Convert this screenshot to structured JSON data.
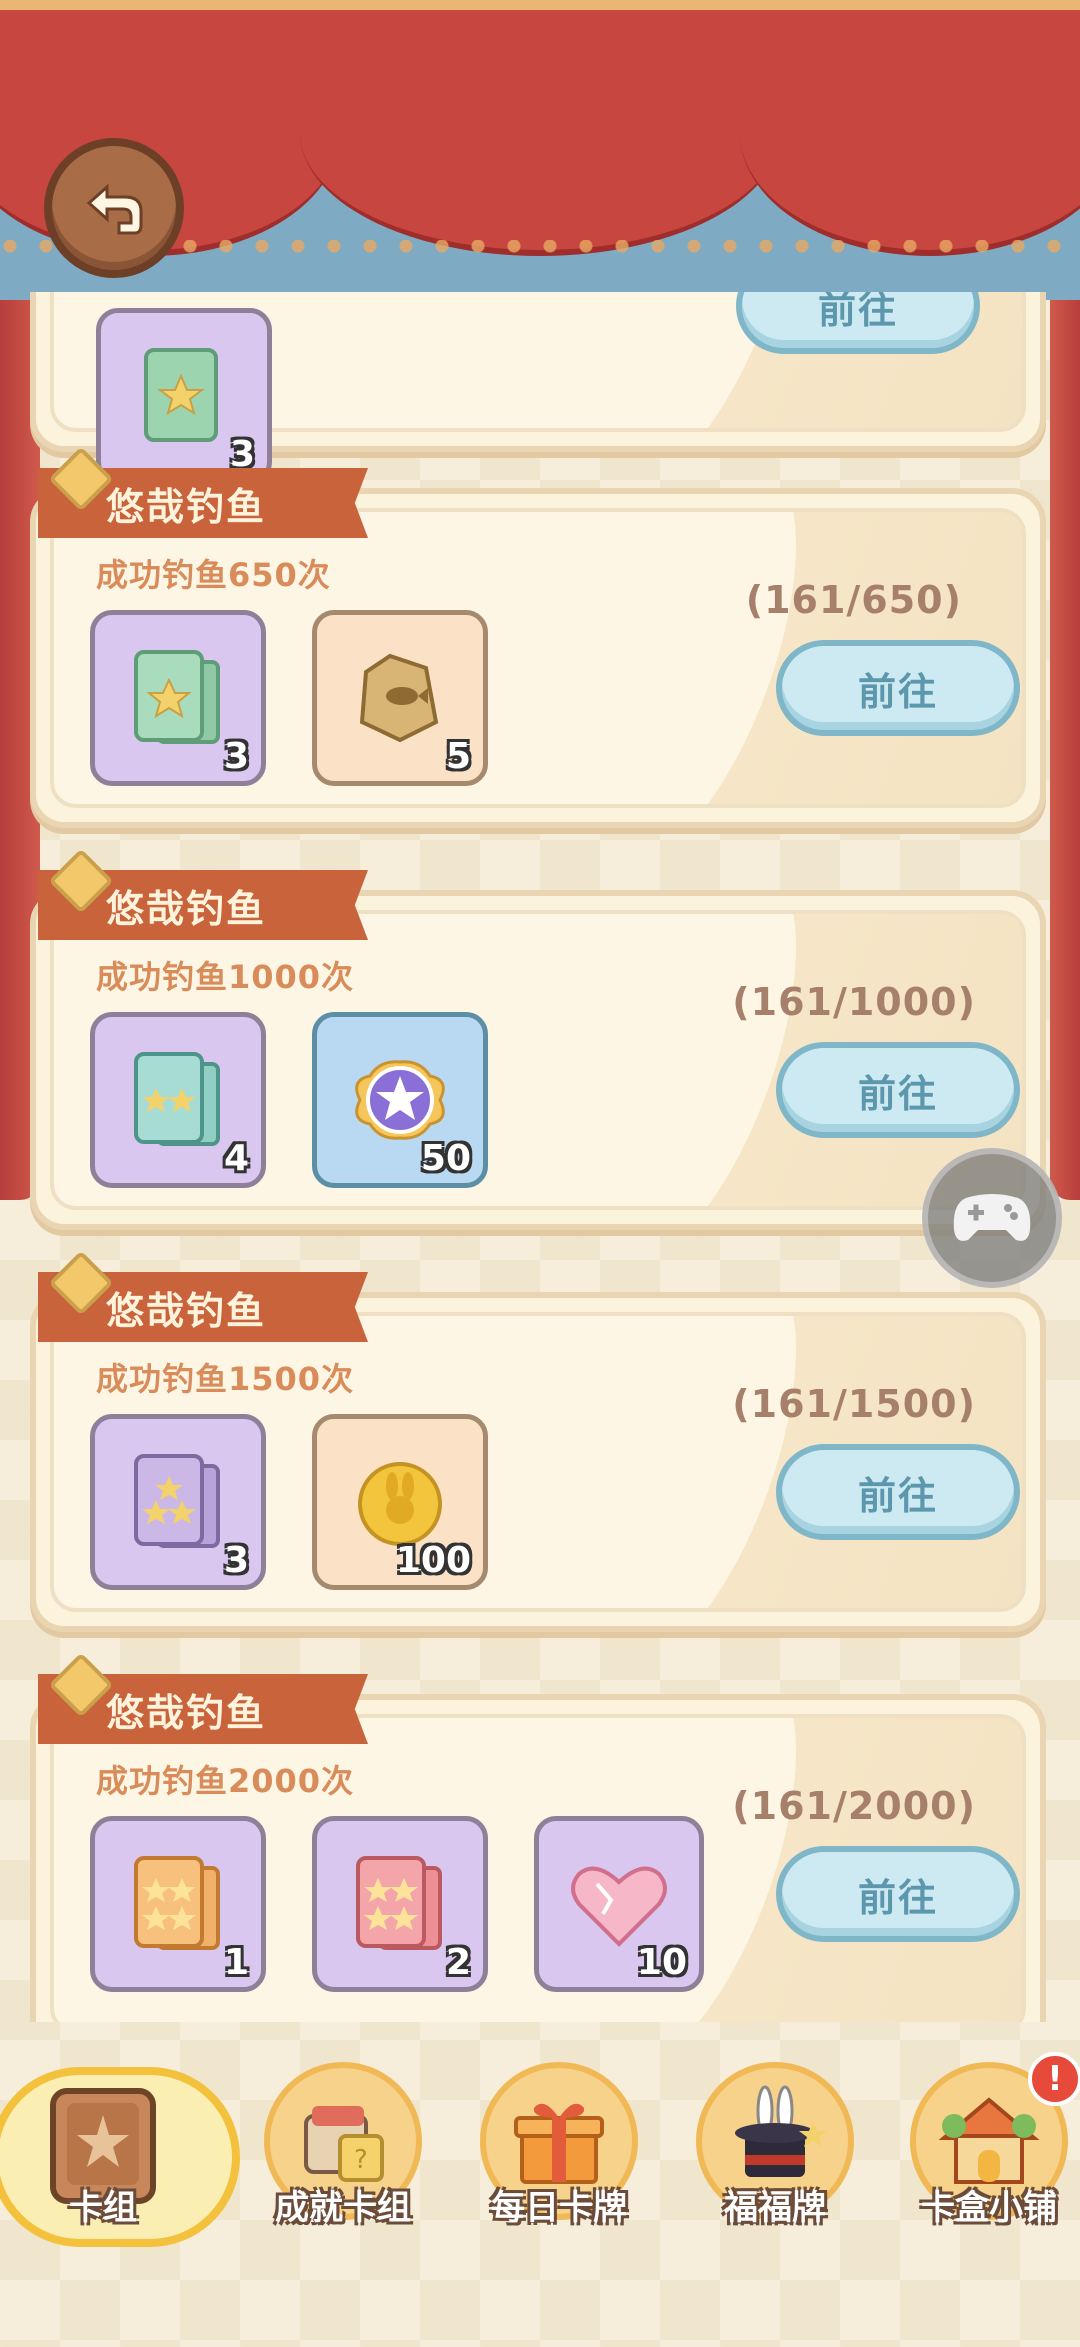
{
  "header": {
    "back_label": ""
  },
  "tasks": [
    {
      "title": "",
      "rewards": [
        {
          "icon": "star-pack-icon",
          "count": "3"
        }
      ],
      "button": "前往"
    },
    {
      "title": "悠哉钓鱼",
      "subtitle": "成功钓鱼650次",
      "progress": "(161/650)",
      "button": "前往",
      "rewards": [
        {
          "icon": "green-star-pack-icon",
          "count": "3"
        },
        {
          "icon": "fish-food-bag-icon",
          "count": "5"
        }
      ]
    },
    {
      "title": "悠哉钓鱼",
      "subtitle": "成功钓鱼1000次",
      "progress": "(161/1000)",
      "button": "前往",
      "rewards": [
        {
          "icon": "two-star-pack-icon",
          "count": "4"
        },
        {
          "icon": "star-badge-icon",
          "count": "50"
        }
      ]
    },
    {
      "title": "悠哉钓鱼",
      "subtitle": "成功钓鱼1500次",
      "progress": "(161/1500)",
      "button": "前往",
      "rewards": [
        {
          "icon": "three-star-pack-icon",
          "count": "3"
        },
        {
          "icon": "rabbit-coin-icon",
          "count": "100"
        }
      ]
    },
    {
      "title": "悠哉钓鱼",
      "subtitle": "成功钓鱼2000次",
      "progress": "(161/2000)",
      "button": "前往",
      "rewards": [
        {
          "icon": "four-star-orange-pack-icon",
          "count": "1"
        },
        {
          "icon": "four-star-pink-pack-icon",
          "count": "2"
        },
        {
          "icon": "heart-gem-icon",
          "count": "10"
        }
      ]
    }
  ],
  "nav": {
    "items": [
      {
        "label": "卡组",
        "icon": "card-book-icon"
      },
      {
        "label": "成就卡组",
        "icon": "achievement-cards-icon"
      },
      {
        "label": "每日卡牌",
        "icon": "gift-box-icon"
      },
      {
        "label": "福福牌",
        "icon": "magic-hat-icon"
      },
      {
        "label": "卡盒小铺",
        "icon": "shop-house-icon"
      }
    ],
    "badge": "!"
  },
  "colors": {
    "ribbon": "#c9633b",
    "button": "#cdeaf2",
    "curtain": "#c7463f"
  }
}
